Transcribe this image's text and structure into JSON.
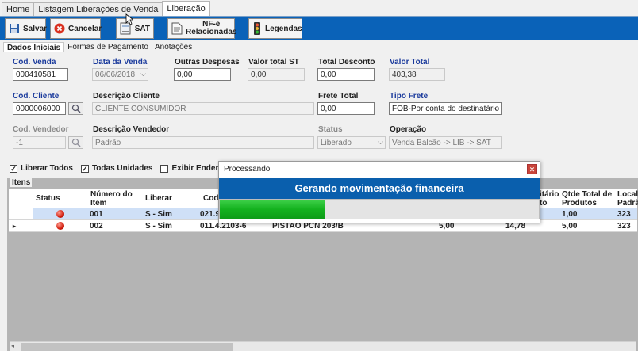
{
  "top_tabs": [
    "Home",
    "Listagem Liberações de Venda",
    "Liberação"
  ],
  "toolbar": {
    "salvar": "Salvar",
    "cancelar": "Cancelar",
    "sat": "SAT",
    "nfe_line1": "NF-e",
    "nfe_line2": "Relacionadas",
    "legendas": "Legendas"
  },
  "inner_tabs": [
    "Dados Iniciais",
    "Formas de Pagamento",
    "Anotações"
  ],
  "form": {
    "cod_venda": {
      "label": "Cod. Venda",
      "value": "000410581"
    },
    "data_venda": {
      "label": "Data da Venda",
      "value": "06/06/2018"
    },
    "outras_despesas": {
      "label": "Outras Despesas",
      "value": "0,00"
    },
    "valor_total_st": {
      "label": "Valor total ST",
      "value": "0,00"
    },
    "total_desconto": {
      "label": "Total Desconto",
      "value": "0,00"
    },
    "valor_total": {
      "label": "Valor Total",
      "value": "403,38"
    },
    "cod_cliente": {
      "label": "Cod. Cliente",
      "value": "0000006000"
    },
    "descricao_cliente": {
      "label": "Descrição Cliente",
      "value": "CLIENTE CONSUMIDOR"
    },
    "frete_total": {
      "label": "Frete Total",
      "value": "0,00"
    },
    "tipo_frete": {
      "label": "Tipo Frete",
      "value": "FOB-Por conta do destinatário"
    },
    "cod_vendedor": {
      "label": "Cod. Vendedor",
      "value": "-1"
    },
    "descricao_vendedor": {
      "label": "Descrição Vendedor",
      "value": "Padrão"
    },
    "status": {
      "label": "Status",
      "value": "Liberado"
    },
    "operacao": {
      "label": "Operação",
      "value": "Venda Balcão -> LIB -> SAT"
    }
  },
  "checks": {
    "liberar_todos": "Liberar Todos",
    "todas_unidades": "Todas Unidades",
    "exibir_endereco": "Exibir Endereço"
  },
  "grid": {
    "title": "Itens",
    "headers": {
      "status": "Status",
      "numero_l1": "Número do",
      "numero_l2": "Item",
      "liberar": "Liberar",
      "cod": "Cod.",
      "unitario_l1": "itário",
      "unitario_l2": "to",
      "qtde_l1": "Qtde Total de",
      "qtde_l2": "Produtos",
      "local_l1": "Locali",
      "local_l2": "Padrã"
    },
    "rows": [
      {
        "numero": "001",
        "liberar": "S - Sim",
        "cod": "021.9",
        "descricao": "",
        "qtd": "",
        "unit": "",
        "qtde_total": "1,00",
        "local": "323"
      },
      {
        "numero": "002",
        "liberar": "S - Sim",
        "cod": "011.4.2103-6",
        "descricao": "PISTAO PCN 203/B",
        "qtd": "5,00",
        "unit": "14,78",
        "qtde_total": "5,00",
        "local": "323"
      }
    ]
  },
  "dialog": {
    "title": "Processando",
    "message": "Gerando movimentação financeira",
    "progress": 0.33
  }
}
